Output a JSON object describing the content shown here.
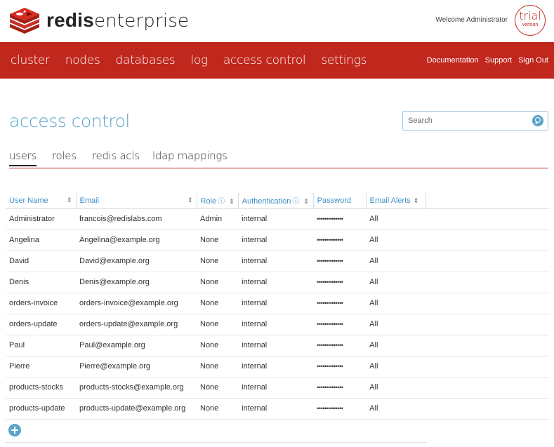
{
  "brand": {
    "strong": "redis",
    "light": "enterprise"
  },
  "header": {
    "welcome": "Welcome Administrator",
    "trial_line1": "trial",
    "trial_line2": "version"
  },
  "nav": {
    "items": [
      "cluster",
      "nodes",
      "databases",
      "log",
      "access control",
      "settings"
    ],
    "links": [
      "Documentation",
      "Support",
      "Sign Out"
    ]
  },
  "page": {
    "title": "access control"
  },
  "search": {
    "placeholder": "Search",
    "value": ""
  },
  "tabs": [
    "users",
    "roles",
    "redis acls",
    "ldap mappings"
  ],
  "active_tab": "users",
  "table": {
    "columns": [
      "User Name",
      "Email",
      "Role",
      "Authentication",
      "Password",
      "Email Alerts"
    ],
    "rows": [
      [
        "Administrator",
        "francois@redislabs.com",
        "Admin",
        "internal",
        "••••••••••••••",
        "All"
      ],
      [
        "Angelina",
        "Angelina@example.org",
        "None",
        "internal",
        "••••••••••••••",
        "All"
      ],
      [
        "David",
        "David@example.org",
        "None",
        "internal",
        "••••••••••••••",
        "All"
      ],
      [
        "Denis",
        "Denis@example.org",
        "None",
        "internal",
        "••••••••••••••",
        "All"
      ],
      [
        "orders-invoice",
        "orders-invoice@example.org",
        "None",
        "internal",
        "••••••••••••••",
        "All"
      ],
      [
        "orders-update",
        "orders-update@example.org",
        "None",
        "internal",
        "••••••••••••••",
        "All"
      ],
      [
        "Paul",
        "Paul@example.org",
        "None",
        "internal",
        "••••••••••••••",
        "All"
      ],
      [
        "Pierre",
        "Pierre@example.org",
        "None",
        "internal",
        "••••••••••••••",
        "All"
      ],
      [
        "products-stocks",
        "products-stocks@example.org",
        "None",
        "internal",
        "••••••••••••••",
        "All"
      ],
      [
        "products-update",
        "products-update@example.org",
        "None",
        "internal",
        "••••••••••••••",
        "All"
      ]
    ]
  },
  "icons": {
    "add": "plus-circle-icon",
    "search": "search-icon",
    "sort": "sort-icon",
    "info": "info-icon"
  },
  "colors": {
    "brand_red": "#c0271d",
    "accent_blue": "#5aa4c8",
    "link_blue": "#3e8fc4"
  }
}
